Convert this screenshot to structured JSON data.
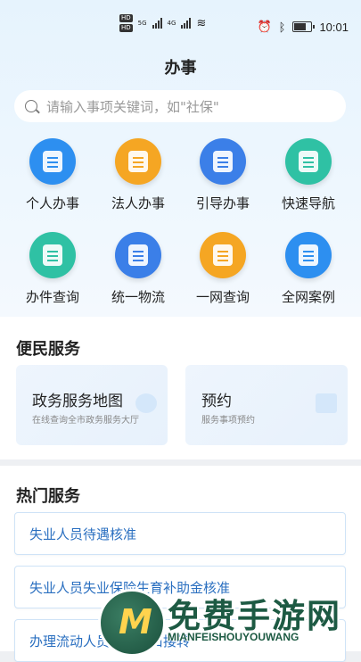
{
  "statusbar": {
    "time": "10:01",
    "net1": "5G",
    "net2": "4G",
    "hd": "HD"
  },
  "header": {
    "title": "办事"
  },
  "search": {
    "placeholder": "请输入事项关键词，如\"社保\""
  },
  "quick": [
    {
      "label": "个人办事",
      "icon": "personal-affairs-icon",
      "color": "#2d8ff0"
    },
    {
      "label": "法人办事",
      "icon": "legal-person-icon",
      "color": "#f5a623"
    },
    {
      "label": "引导办事",
      "icon": "guide-icon",
      "color": "#3b7fe8"
    },
    {
      "label": "快速导航",
      "icon": "navigation-icon",
      "color": "#2fc1a4"
    },
    {
      "label": "办件查询",
      "icon": "case-query-icon",
      "color": "#2fc1a4"
    },
    {
      "label": "统一物流",
      "icon": "logistics-icon",
      "color": "#3b7fe8"
    },
    {
      "label": "一网查询",
      "icon": "globe-icon",
      "color": "#f5a623"
    },
    {
      "label": "全网案例",
      "icon": "briefcase-icon",
      "color": "#2d8ff0"
    }
  ],
  "convenience": {
    "title": "便民服务",
    "cards": [
      {
        "title": "政务服务地图",
        "subtitle": "在线查询全市政务服务大厅",
        "icon": "map-pin-icon"
      },
      {
        "title": "预约",
        "subtitle": "服务事项预约",
        "icon": "calendar-icon"
      }
    ]
  },
  "hot": {
    "title": "热门服务",
    "items": [
      "失业人员待遇核准",
      "失业人员失业保险生育补助金核准",
      "办理流动人员某种户口接转"
    ]
  },
  "watermark": {
    "text": "免费手游网",
    "sub": "MIANFEISHOUYOUWANG",
    "logo": "M"
  }
}
